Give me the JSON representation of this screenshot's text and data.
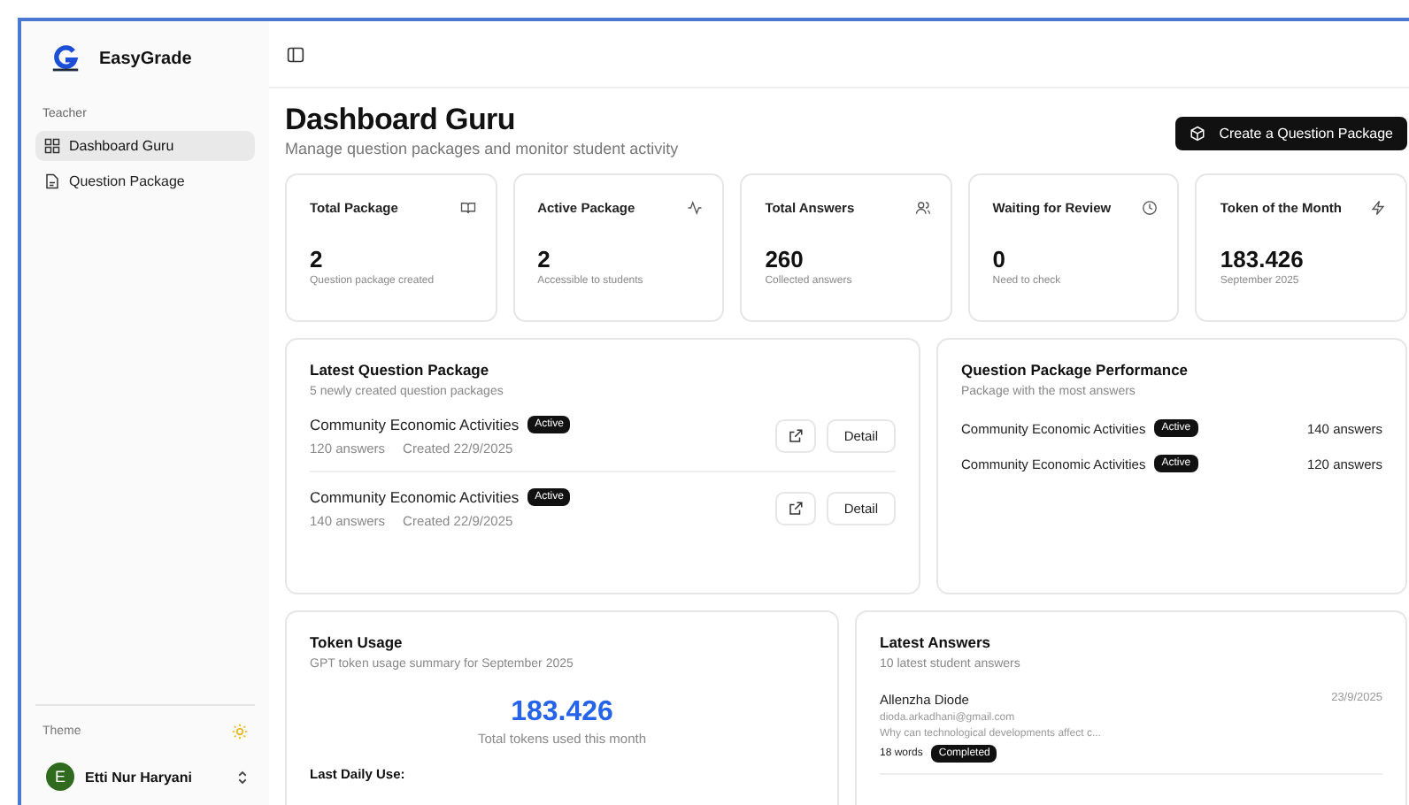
{
  "sidebar": {
    "brand": "EasyGrade",
    "section": "Teacher",
    "items": [
      {
        "label": "Dashboard Guru",
        "kind": "grid",
        "selected": true
      },
      {
        "label": "Question Package",
        "kind": "document",
        "selected": false
      }
    ],
    "theme": {
      "label": "Theme"
    },
    "user": {
      "initial": "E",
      "name": "Etti Nur Haryani"
    }
  },
  "header": {
    "title": "Dashboard Guru",
    "subtitle": "Manage question packages and monitor student activity",
    "button": "Create a Question Package"
  },
  "stats": [
    {
      "title": "Total Package",
      "value": "2",
      "caption": "Question package created",
      "kind": "book"
    },
    {
      "title": "Active Package",
      "value": "2",
      "caption": "Accessible to students",
      "kind": "activity"
    },
    {
      "title": "Total Answers",
      "value": "260",
      "caption": "Collected answers",
      "kind": "users"
    },
    {
      "title": "Waiting for Review",
      "value": "0",
      "caption": "Need to check",
      "kind": "clock"
    },
    {
      "title": "Token of the Month",
      "value": "183.426",
      "caption": "September 2025",
      "kind": "zap"
    }
  ],
  "latest_packages": {
    "title": "Latest Question Package",
    "subtitle": "5 newly created question packages",
    "items": [
      {
        "name": "Community Economic Activities",
        "status": "Active",
        "answers": "120 answers",
        "created": "Created 22/9/2025",
        "action": "Detail"
      },
      {
        "name": "Community Economic Activities",
        "status": "Active",
        "answers": "140 answers",
        "created": "Created 22/9/2025",
        "action": "Detail"
      }
    ]
  },
  "performance": {
    "title": "Question Package Performance",
    "subtitle": "Package with the most answers",
    "items": [
      {
        "name": "Community Economic Activities",
        "status": "Active",
        "answers": "140 answers"
      },
      {
        "name": "Community Economic Activities",
        "status": "Active",
        "answers": "120 answers"
      }
    ]
  },
  "token_usage": {
    "title": "Token Usage",
    "subtitle": "GPT token usage summary for September 2025",
    "total": "183.426",
    "caption": "Total tokens used this month",
    "daily_label": "Last Daily Use:"
  },
  "latest_answers": {
    "title": "Latest Answers",
    "subtitle": "10 latest student answers",
    "items": [
      {
        "name": "Allenzha Diode",
        "email": "dioda.arkadhani@gmail.com",
        "excerpt": "Why can technological developments affect c...",
        "words": "18 words",
        "status": "Completed",
        "date": "23/9/2025"
      }
    ]
  }
}
